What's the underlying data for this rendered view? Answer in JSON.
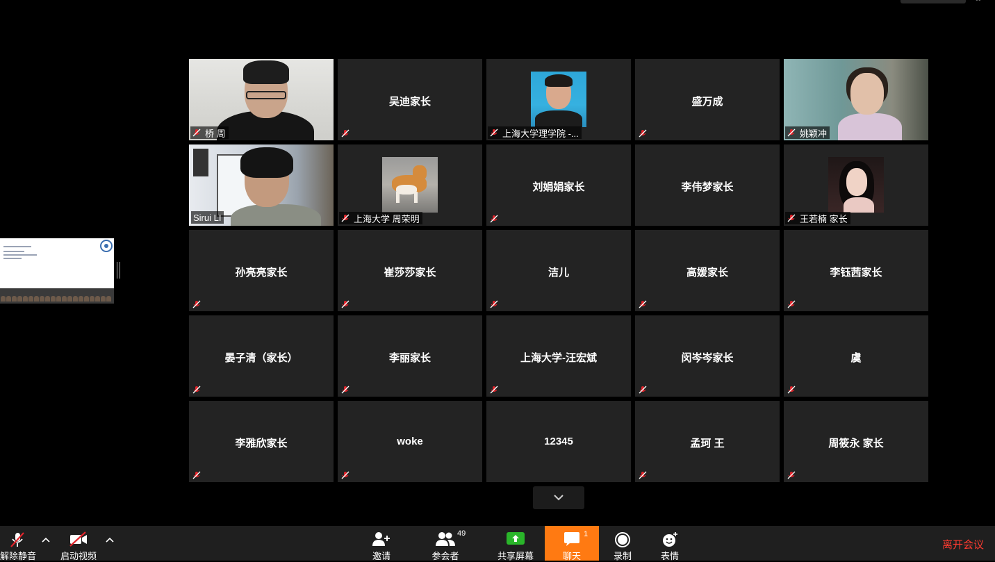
{
  "window": {
    "top_menu_glyph": "••"
  },
  "grid": {
    "tiles": [
      {
        "name": "桥 周",
        "kind": "video",
        "muted": true
      },
      {
        "name": "吴迪家长",
        "kind": "name",
        "muted": true
      },
      {
        "name": "上海大学理学院 -...",
        "kind": "avatar",
        "muted": true
      },
      {
        "name": "盛万成",
        "kind": "name",
        "muted": true
      },
      {
        "name": "姚颖冲",
        "kind": "video",
        "muted": true
      },
      {
        "name": "Sirui LI",
        "kind": "video",
        "muted": false,
        "active_speaker": true
      },
      {
        "name": "上海大学 周荣明",
        "kind": "avatar",
        "muted": true
      },
      {
        "name": "刘娟娟家长",
        "kind": "name",
        "muted": true
      },
      {
        "name": "李伟梦家长",
        "kind": "name",
        "muted": false
      },
      {
        "name": "王若楠 家长",
        "kind": "avatar",
        "muted": true
      },
      {
        "name": "孙亮亮家长",
        "kind": "name",
        "muted": true
      },
      {
        "name": "崔莎莎家长",
        "kind": "name",
        "muted": true
      },
      {
        "name": "洁儿",
        "kind": "name",
        "muted": true
      },
      {
        "name": "高媛家长",
        "kind": "name",
        "muted": true
      },
      {
        "name": "李钰茜家长",
        "kind": "name",
        "muted": true
      },
      {
        "name": "晏子清（家长）",
        "kind": "name",
        "muted": true
      },
      {
        "name": "李丽家长",
        "kind": "name",
        "muted": true
      },
      {
        "name": "上海大学-汪宏斌",
        "kind": "name",
        "muted": true
      },
      {
        "name": "闵岑岑家长",
        "kind": "name",
        "muted": true
      },
      {
        "name": "虞",
        "kind": "name",
        "muted": true
      },
      {
        "name": "李雅欣家长",
        "kind": "name",
        "muted": true
      },
      {
        "name": "woke",
        "kind": "name",
        "muted": true
      },
      {
        "name": "12345",
        "kind": "name",
        "muted": false
      },
      {
        "name": "孟珂 王",
        "kind": "name",
        "muted": true
      },
      {
        "name": "周筱永 家长",
        "kind": "name",
        "muted": true
      }
    ],
    "scroll_icon": "chevron-down-icon"
  },
  "toolbar": {
    "unmute": {
      "label": "解除静音",
      "icon": "mic-muted-icon"
    },
    "start_video": {
      "label": "启动视频",
      "icon": "video-off-icon"
    },
    "invite": {
      "label": "邀请",
      "icon": "add-user-icon"
    },
    "participants": {
      "label": "参会者",
      "icon": "participants-icon",
      "count": "49"
    },
    "share_screen": {
      "label": "共享屏幕",
      "icon": "share-screen-icon"
    },
    "chat": {
      "label": "聊天",
      "icon": "chat-icon",
      "badge": "1"
    },
    "record": {
      "label": "录制",
      "icon": "record-icon"
    },
    "reactions": {
      "label": "表情",
      "icon": "emoji-icon"
    },
    "leave": {
      "label": "离开会议"
    }
  },
  "colors": {
    "background": "#000000",
    "tile": "#232323",
    "toolbar": "#1f1f1f",
    "active_speaker": "#c8da58",
    "chat_accent": "#ff7a12",
    "share_green": "#2ab52a",
    "muted_red": "#e0242b",
    "leave_red": "#ff3b30"
  }
}
